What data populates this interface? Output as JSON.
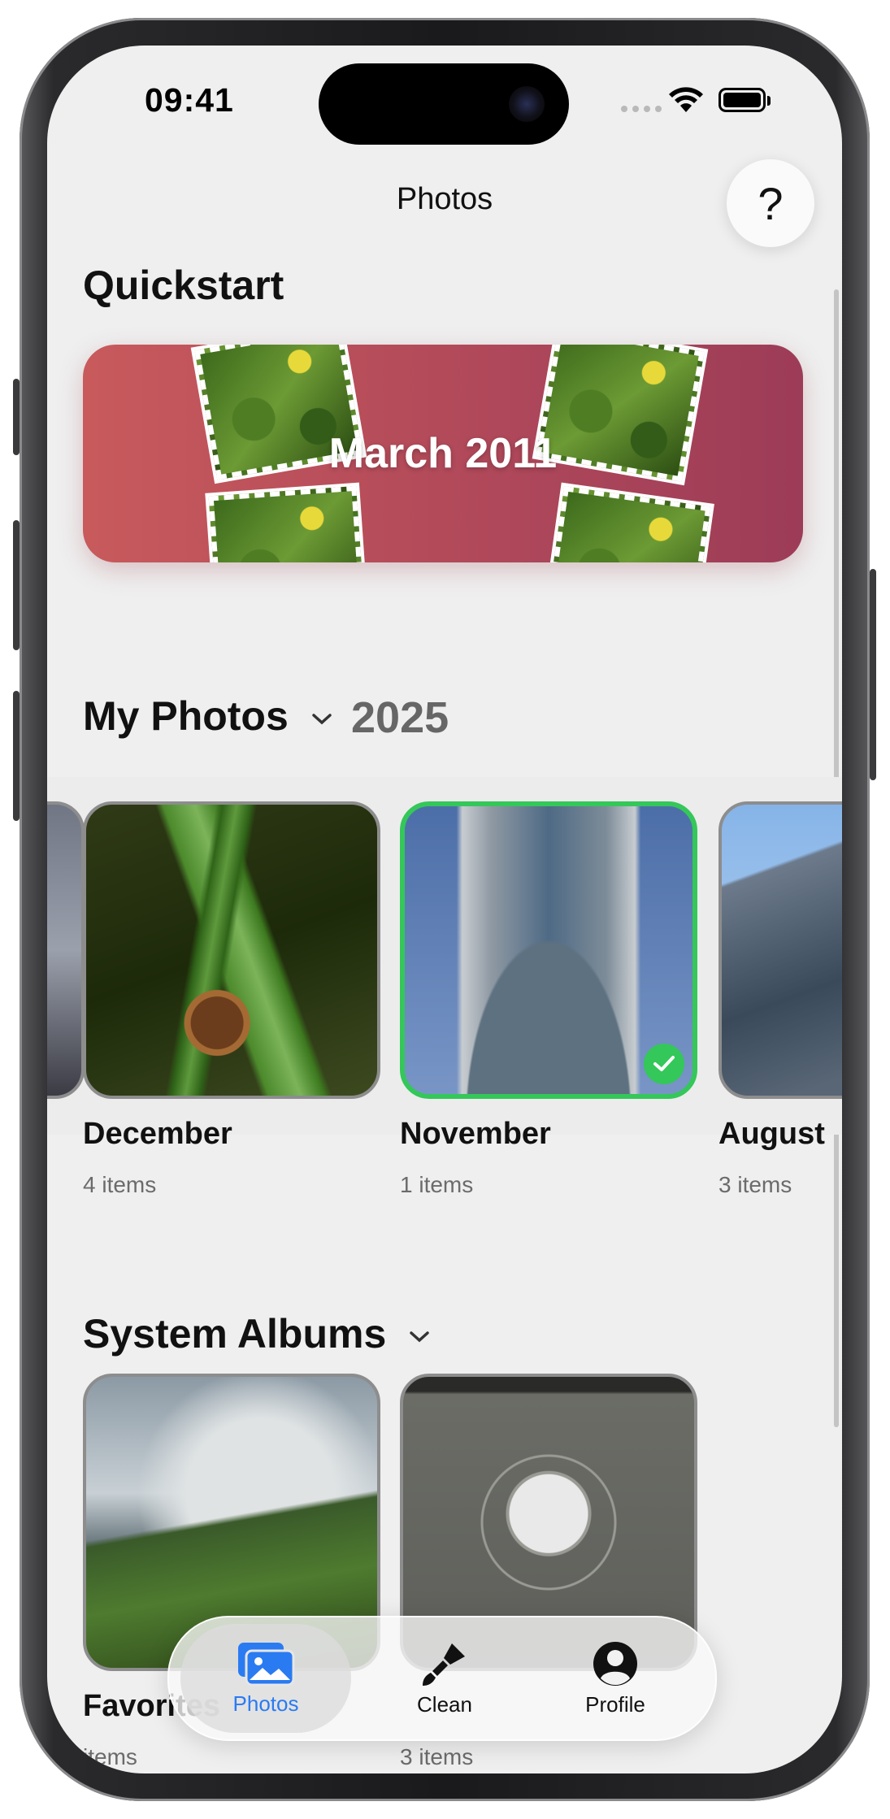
{
  "status_bar": {
    "time": "09:41"
  },
  "nav": {
    "title": "Photos",
    "help_glyph": "?"
  },
  "quickstart": {
    "title": "Quickstart",
    "banner_text": "March 2011"
  },
  "my_photos": {
    "title": "My Photos",
    "year": "2025",
    "albums": [
      {
        "title": "December",
        "count": "4 items"
      },
      {
        "title": "November",
        "count": "1 items",
        "selected": true
      },
      {
        "title": "August",
        "count": "3 items"
      }
    ]
  },
  "system_albums": {
    "title": "System Albums",
    "albums": [
      {
        "title": "Favorites",
        "count": "items"
      },
      {
        "title": "",
        "count": "3 items"
      }
    ]
  },
  "tabbar": {
    "tabs": [
      {
        "label": "Photos",
        "icon": "photos-icon",
        "active": true
      },
      {
        "label": "Clean",
        "icon": "brush-icon"
      },
      {
        "label": "Profile",
        "icon": "profile-icon"
      }
    ]
  },
  "colors": {
    "accent": "#2a7bf2",
    "selected": "#34c759",
    "banner_start": "#c85a5c",
    "banner_end": "#9d3c58"
  }
}
